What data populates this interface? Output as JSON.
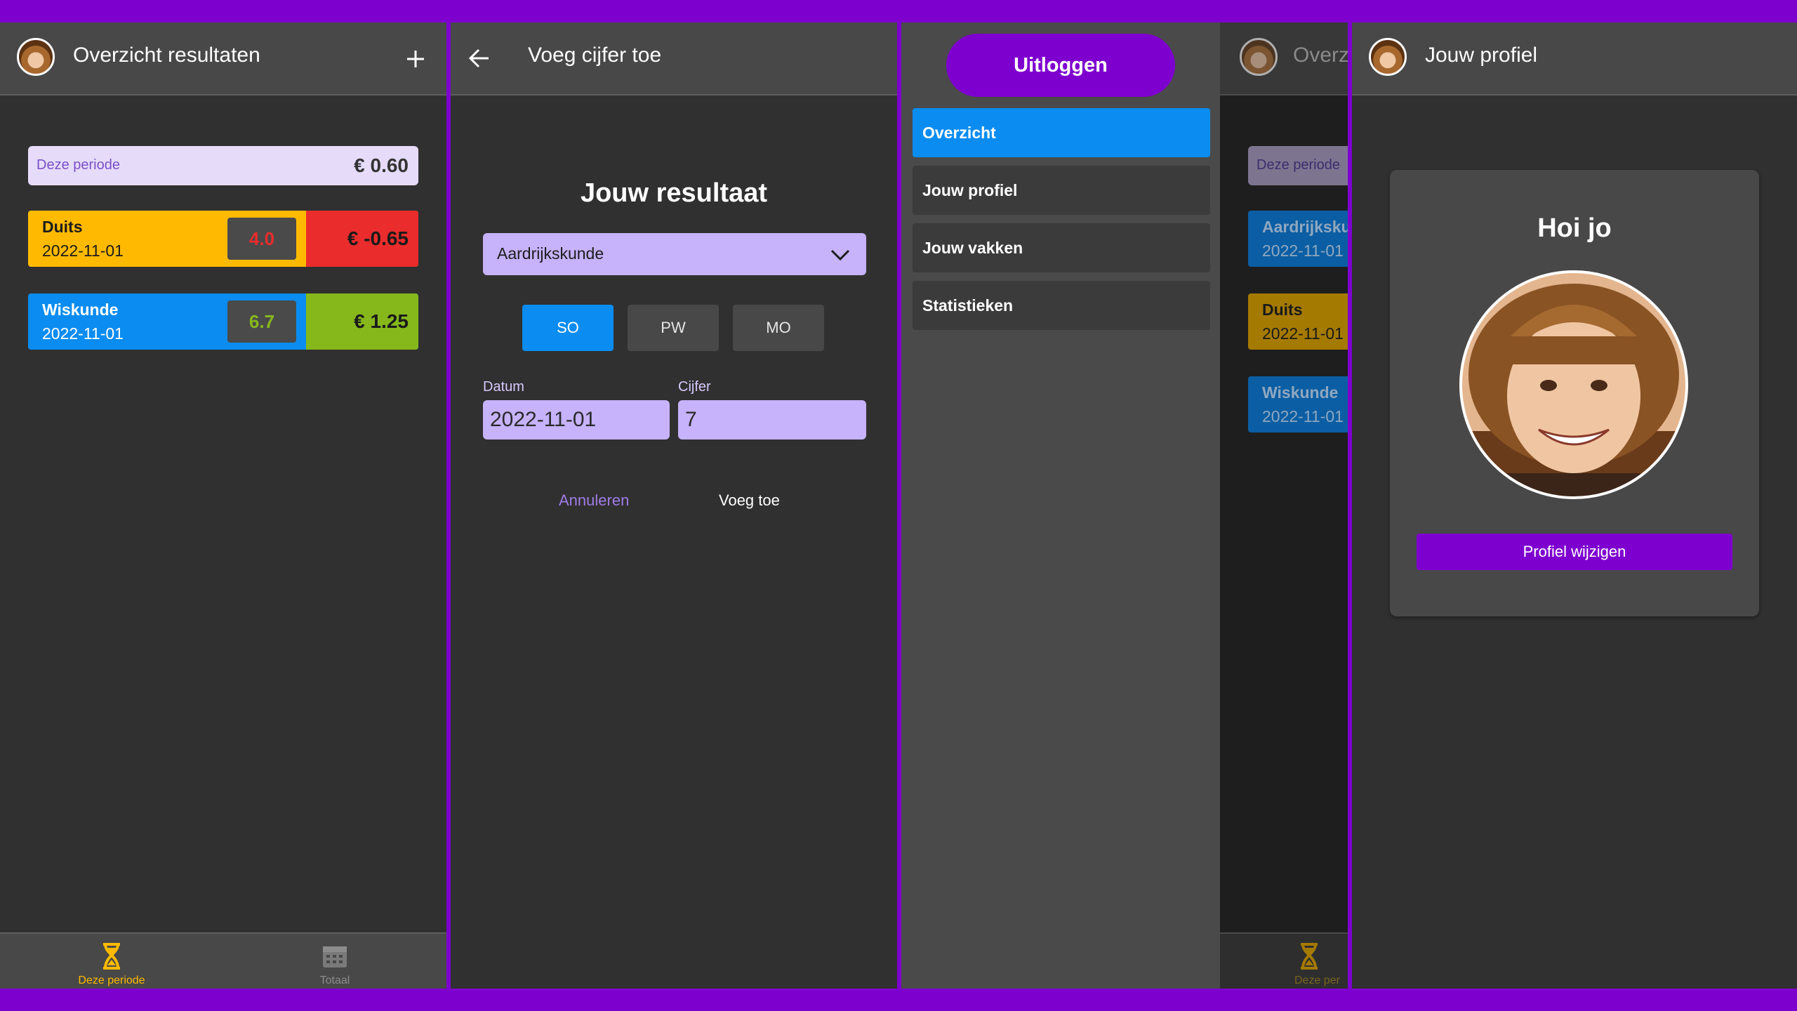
{
  "screen1": {
    "title": "Overzicht resultaten",
    "add_icon": "plus-icon",
    "period": {
      "label": "Deze periode",
      "amount": "€ 0.60"
    },
    "results": [
      {
        "subject": "Duits",
        "date": "2022-11-01",
        "grade": "4.0",
        "amount": "€ -0.65"
      },
      {
        "subject": "Wiskunde",
        "date": "2022-11-01",
        "grade": "6.7",
        "amount": "€ 1.25"
      }
    ],
    "nav": [
      {
        "label": "Deze periode",
        "icon": "hourglass-icon"
      },
      {
        "label": "Totaal",
        "icon": "calendar-icon"
      }
    ]
  },
  "screen2": {
    "title": "Voeg cijfer toe",
    "heading": "Jouw resultaat",
    "subject_value": "Aardrijkskunde",
    "types": [
      "SO",
      "PW",
      "MO"
    ],
    "date_label": "Datum",
    "date_value": "2022-11-01",
    "grade_label": "Cijfer",
    "grade_value": "7",
    "cancel_label": "Annuleren",
    "add_label": "Voeg toe"
  },
  "screen3": {
    "logout_label": "Uitloggen",
    "menu": [
      "Overzicht",
      "Jouw profiel",
      "Jouw vakken",
      "Statistieken"
    ],
    "behind": {
      "title": "Overz",
      "period_label": "Deze periode",
      "subjects": [
        {
          "name": "Aardrijksku",
          "date": "2022-11-01"
        },
        {
          "name": "Duits",
          "date": "2022-11-01"
        },
        {
          "name": "Wiskunde",
          "date": "2022-11-01"
        }
      ],
      "nav_label": "Deze per"
    }
  },
  "screen4": {
    "title": "Jouw profiel",
    "greeting": "Hoi jo",
    "edit_label": "Profiel wijzigen"
  },
  "colors": {
    "purple": "#7e00cf",
    "blue": "#0b8cf0",
    "yellow": "#ffba00",
    "red": "#ea2c2c",
    "green": "#86b81c",
    "lavender": "#c6b3fb"
  }
}
